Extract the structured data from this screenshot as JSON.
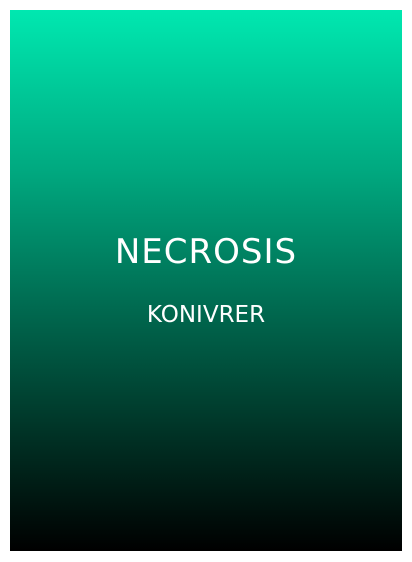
{
  "card": {
    "title": "NECROSIS",
    "subtitle": "KONIVRER",
    "gradient_top_color": "#00e8b0",
    "gradient_bottom_color": "#000000",
    "text_color": "#ffffff"
  }
}
